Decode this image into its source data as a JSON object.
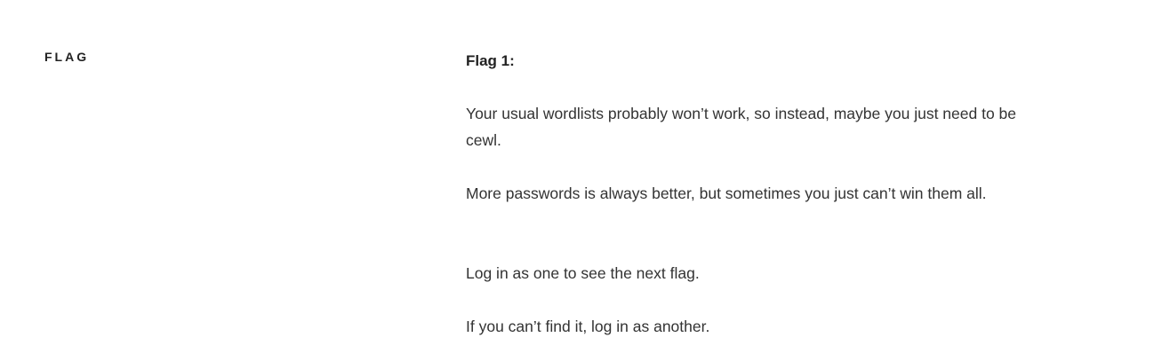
{
  "section": {
    "title": "FLAG"
  },
  "content": {
    "heading": "Flag 1:",
    "paragraphs": [
      "Your usual wordlists probably won’t work, so instead, maybe you just need to be cewl.",
      "More passwords is always better, but sometimes you just can’t win them all.",
      "Log in as one to see the next flag.",
      "If you can’t find it, log in as another."
    ]
  }
}
